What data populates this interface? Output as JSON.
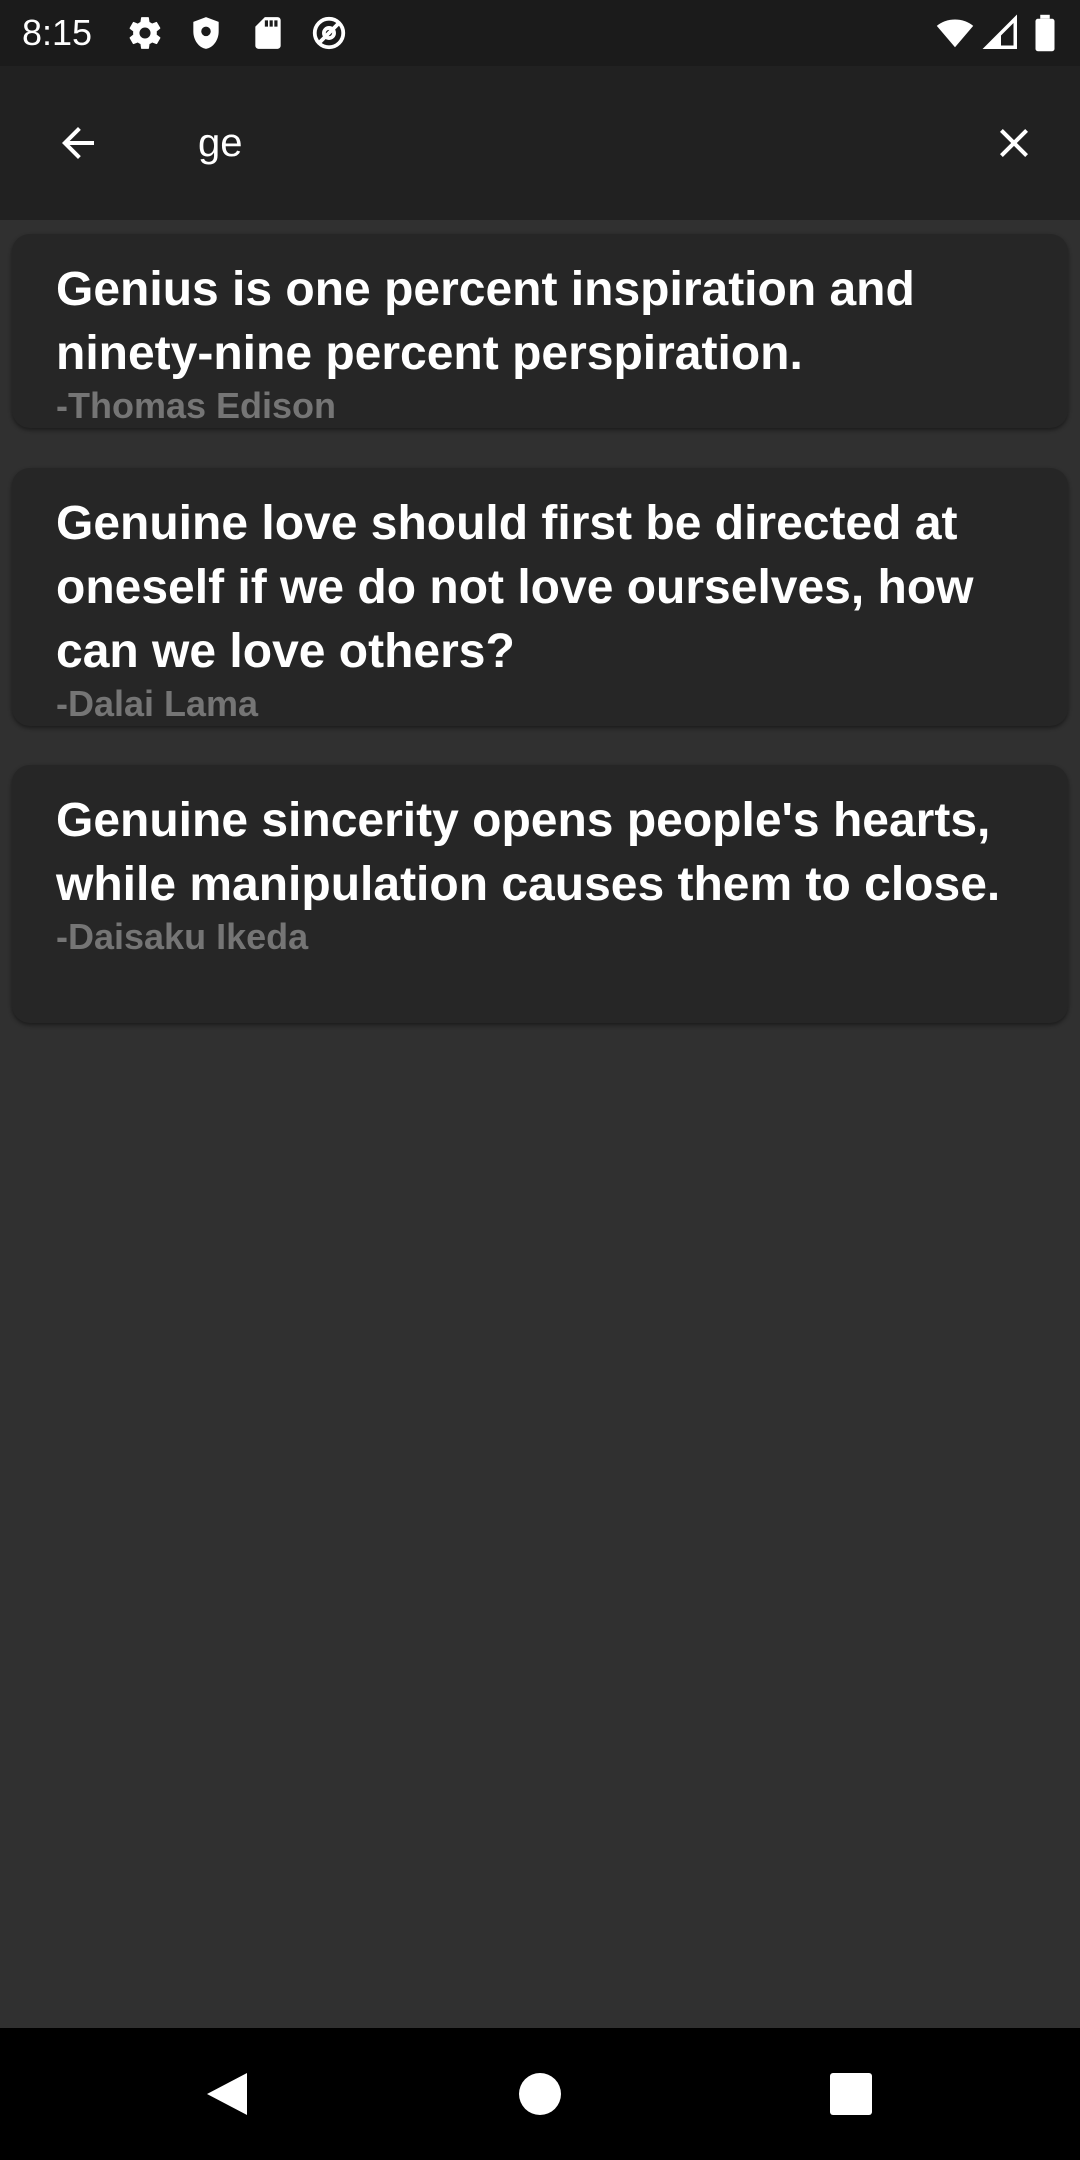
{
  "status_bar": {
    "time": "8:15",
    "left_icons": [
      "settings-icon",
      "shield-icon",
      "sd-card-icon",
      "at-sign-icon"
    ],
    "right_icons": [
      "wifi-icon",
      "cell-signal-icon",
      "battery-icon"
    ]
  },
  "toolbar": {
    "back_icon": "arrow-back-icon",
    "search_query": "ge",
    "clear_icon": "close-icon"
  },
  "results": [
    {
      "quote": "Genius is one percent inspiration and ninety-nine percent perspiration.",
      "author": "-Thomas Edison"
    },
    {
      "quote": "Genuine love should first be directed at oneself if we do not love ourselves, how can we love others?",
      "author": "-Dalai Lama"
    },
    {
      "quote": "Genuine sincerity opens people's hearts, while manipulation causes them to close.",
      "author": "-Daisaku Ikeda"
    }
  ],
  "nav_bar": {
    "icons": [
      "nav-back-icon",
      "nav-home-icon",
      "nav-recents-icon"
    ]
  },
  "colors": {
    "background": "#303030",
    "toolbar": "#212121",
    "card": "#262626",
    "quote_text": "#ffffff",
    "author_text": "#757575"
  }
}
